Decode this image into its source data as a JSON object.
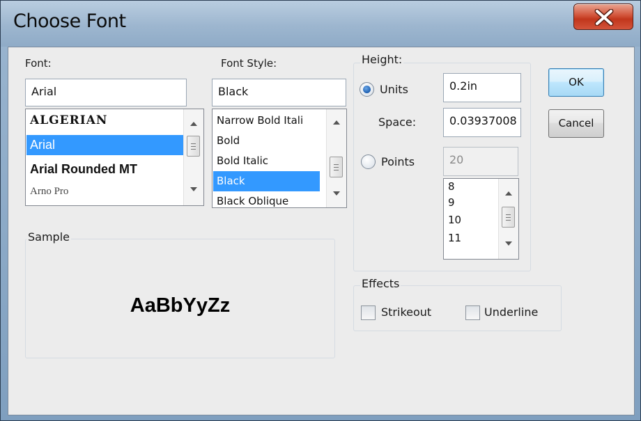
{
  "window": {
    "title": "Choose Font"
  },
  "font": {
    "label": "Font:",
    "value": "Arial",
    "items": [
      "ALGERIAN",
      "Arial",
      "Arial Rounded MT",
      "Arno Pro"
    ],
    "selected": "Arial"
  },
  "style": {
    "label": "Font Style:",
    "value": "Black",
    "items": [
      "Narrow Bold Itali",
      "Bold",
      "Bold Italic",
      "Black",
      "Black Oblique"
    ],
    "selected": "Black"
  },
  "height": {
    "group_title": "Height:",
    "units_label": "Units",
    "units_value": "0.2in",
    "units_selected": true,
    "space_label": "Space:",
    "space_value": "0.03937008",
    "points_label": "Points",
    "points_value": "20",
    "points_items": [
      "8",
      "9",
      "10",
      "11"
    ]
  },
  "sample": {
    "group_title": "Sample",
    "text": "AaBbYyZz"
  },
  "effects": {
    "group_title": "Effects",
    "strikeout_label": "Strikeout",
    "underline_label": "Underline",
    "strikeout_checked": false,
    "underline_checked": false
  },
  "buttons": {
    "ok": "OK",
    "cancel": "Cancel"
  },
  "colors": {
    "selection": "#3399ff",
    "accent": "#c1361c"
  }
}
